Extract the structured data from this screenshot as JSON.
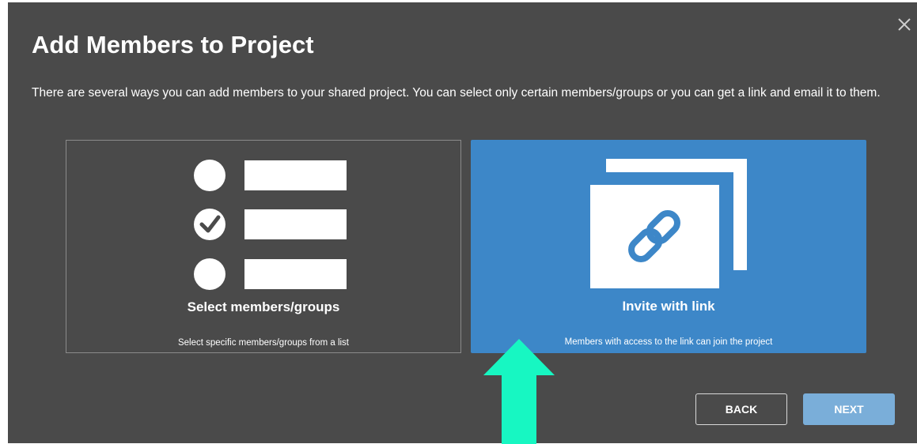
{
  "dialog": {
    "title": "Add Members to Project",
    "description": "There are several ways you can add members to your shared project. You can select only certain members/groups or you can get a link and email it to them.",
    "close_icon": "close-icon"
  },
  "options": [
    {
      "label": "Select members/groups",
      "sublabel": "Select specific members/groups from a list",
      "icon": "list-selection-icon",
      "selected": false
    },
    {
      "label": "Invite with link",
      "sublabel": "Members with access to the link can join the project",
      "icon": "link-icon",
      "selected": true
    }
  ],
  "buttons": {
    "back_label": "BACK",
    "next_label": "NEXT"
  },
  "colors": {
    "dialog_bg": "#4a4a4a",
    "selected_card": "#3d87c8",
    "next_button": "#7aaed9",
    "arrow": "#17f7c2"
  },
  "annotation": {
    "icon": "up-arrow-annotation"
  }
}
